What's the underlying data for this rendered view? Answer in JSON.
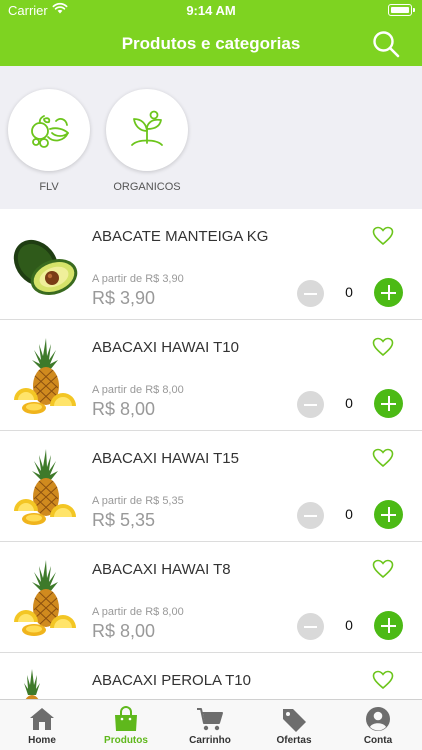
{
  "status_bar": {
    "carrier": "Carrier",
    "time": "9:14 AM"
  },
  "header": {
    "title": "Produtos e categorias"
  },
  "categories": [
    {
      "label": "FLV",
      "icon": "fruits-vegetables-icon"
    },
    {
      "label": "ORGANICOS",
      "icon": "plant-sprout-icon"
    }
  ],
  "products": [
    {
      "name": "ABACATE MANTEIGA KG",
      "from_label": "A partir de R$ 3,90",
      "price": "R$ 3,90",
      "quantity": "0",
      "image": "avocado"
    },
    {
      "name": "ABACAXI HAWAI T10",
      "from_label": "A partir de R$ 8,00",
      "price": "R$ 8,00",
      "quantity": "0",
      "image": "pineapple"
    },
    {
      "name": "ABACAXI HAWAI T15",
      "from_label": "A partir de R$ 5,35",
      "price": "R$ 5,35",
      "quantity": "0",
      "image": "pineapple"
    },
    {
      "name": "ABACAXI HAWAI T8",
      "from_label": "A partir de R$ 8,00",
      "price": "R$ 8,00",
      "quantity": "0",
      "image": "pineapple"
    },
    {
      "name": "ABACAXI PEROLA T10",
      "from_label": "",
      "price": "",
      "quantity": "",
      "image": "pineapple"
    }
  ],
  "tab_bar": {
    "tabs": [
      {
        "label": "Home",
        "icon": "home-icon"
      },
      {
        "label": "Produtos",
        "icon": "shopping-bag-icon",
        "active": true
      },
      {
        "label": "Carrinho",
        "icon": "cart-icon"
      },
      {
        "label": "Ofertas",
        "icon": "tag-icon"
      },
      {
        "label": "Conta",
        "icon": "user-icon"
      }
    ]
  },
  "colors": {
    "brand_green": "#7ed321",
    "add_button_green": "#4cba15",
    "active_tab_green": "#5fb81c",
    "background_gray": "#efeff4"
  }
}
